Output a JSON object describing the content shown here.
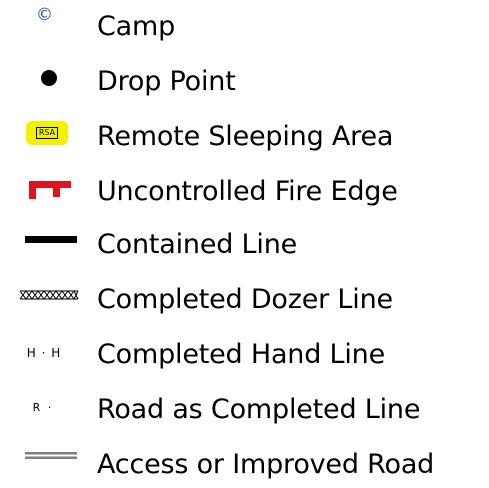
{
  "legend": {
    "items": [
      {
        "symbol": "camp-icon",
        "glyph": "©",
        "label": "Camp",
        "color": "#2c4ea8"
      },
      {
        "symbol": "drop-point-icon",
        "label": "Drop Point",
        "color": "#000000"
      },
      {
        "symbol": "remote-sleeping-area-icon",
        "badge": "RSA",
        "label": "Remote Sleeping Area",
        "color": "#f2f200"
      },
      {
        "symbol": "uncontrolled-fire-edge-icon",
        "label": "Uncontrolled Fire Edge",
        "color": "#e0121b"
      },
      {
        "symbol": "contained-line-icon",
        "label": "Contained Line",
        "color": "#000000"
      },
      {
        "symbol": "completed-dozer-line-icon",
        "label": "Completed Dozer Line",
        "color": "#000000"
      },
      {
        "symbol": "completed-hand-line-icon",
        "glyph": "H · H",
        "label": "Completed Hand Line",
        "color": "#000000"
      },
      {
        "symbol": "road-as-completed-line-icon",
        "glyph": "R ·",
        "label": "Road as Completed Line",
        "color": "#000000"
      },
      {
        "symbol": "access-or-improved-road-icon",
        "label": "Access or Improved Road",
        "color": "#808080"
      }
    ]
  }
}
